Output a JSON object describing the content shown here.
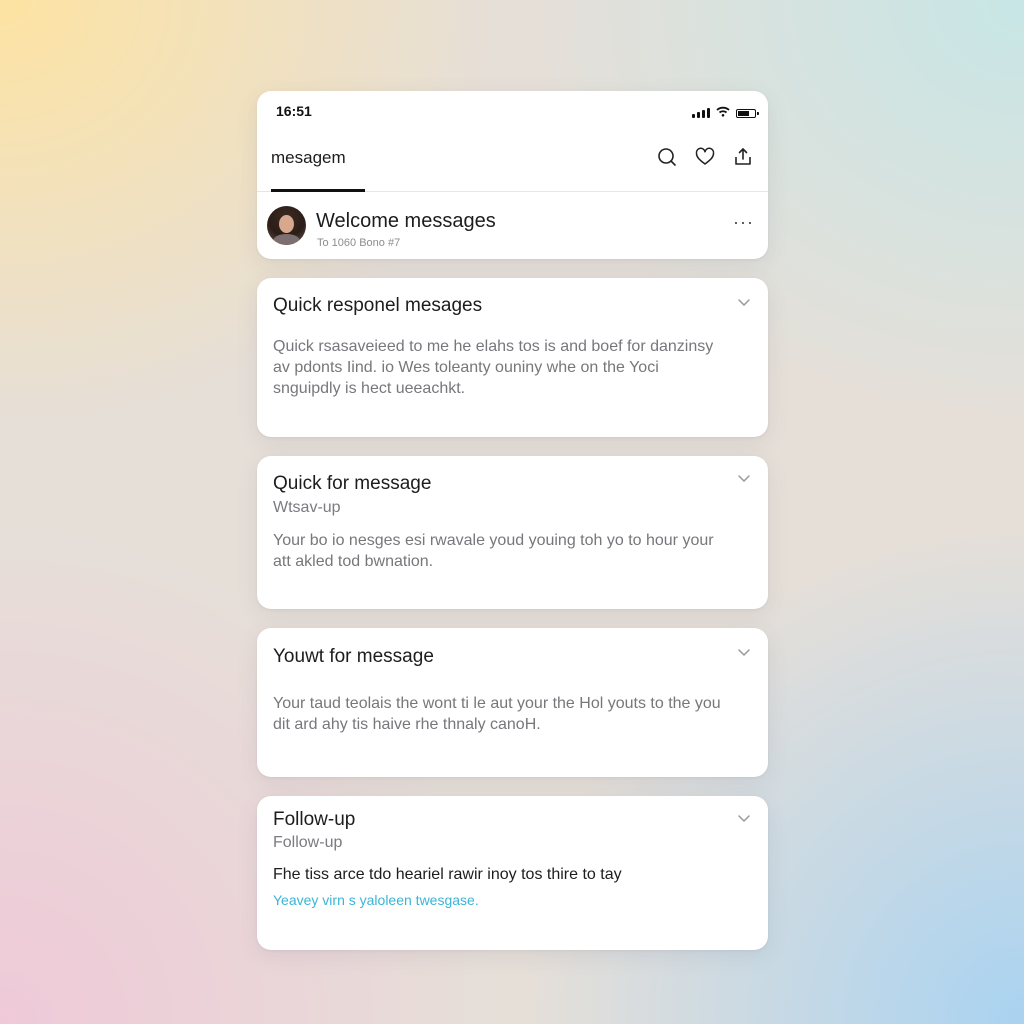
{
  "status_bar": {
    "time": "16:51",
    "battery_level": 0.8
  },
  "header": {
    "tab_label": "mesagem",
    "actions": [
      "search-icon",
      "heart-icon",
      "share-icon"
    ]
  },
  "welcome": {
    "title": "Welcome messages",
    "subtitle": "To 1060 Bono #7",
    "more": "···"
  },
  "cards": [
    {
      "title": "Quick responel mesages",
      "body": "Quick rsasaveieed to me he elahs tos is and boef for danzinsy av pdonts Iind. io Wes toleanty ouniny whe on the Yoci snguipdly is hect ueeachkt."
    },
    {
      "title": "Quick for message",
      "subtitle": "Wtsav-up",
      "body": "Your bo io nesges esi rwavale youd youing toh yo to hour your att akled tod bwnation."
    },
    {
      "title": "Youwt for message",
      "body": "Your taud teolais the wont ti le aut your the Hol youts to the you dit ard ahy tis haive rhe thnaly canoH."
    },
    {
      "title": "Follow-up",
      "subtitle": "Follow-up",
      "body": "Fhe tiss arce tdo heariel rawir inoy tos thire to tay",
      "link": "Yeavey virn s yaloleen twesgase."
    }
  ],
  "colors": {
    "accent_link": "#3bb5d6",
    "text_primary": "#1d1d1f",
    "text_secondary": "#77777c"
  }
}
